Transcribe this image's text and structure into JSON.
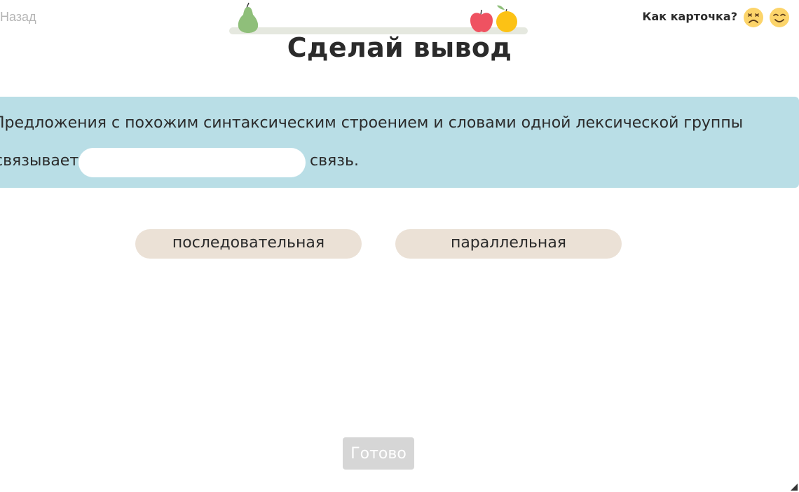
{
  "nav": {
    "back_label": "Назад"
  },
  "progress": {
    "fruits": [
      "pear-icon",
      "apple-icon",
      "orange-icon"
    ]
  },
  "feedback": {
    "label": "Как карточка?",
    "options": [
      "sad-face-icon",
      "happy-face-icon"
    ]
  },
  "title": "Сделай вывод",
  "task": {
    "line1": "Предложения с похожим синтаксическим строением и словами одной лексической группы",
    "line2_before": "связывает",
    "line2_after": "связь.",
    "blank_value": ""
  },
  "options": [
    "последовательная",
    "параллельная"
  ],
  "done_label": "Готово",
  "colors": {
    "panel": "#b9dee6",
    "option_bg": "#ebe1d6",
    "done_disabled": "#d6d6d6",
    "back_link": "#b5b5b5"
  }
}
